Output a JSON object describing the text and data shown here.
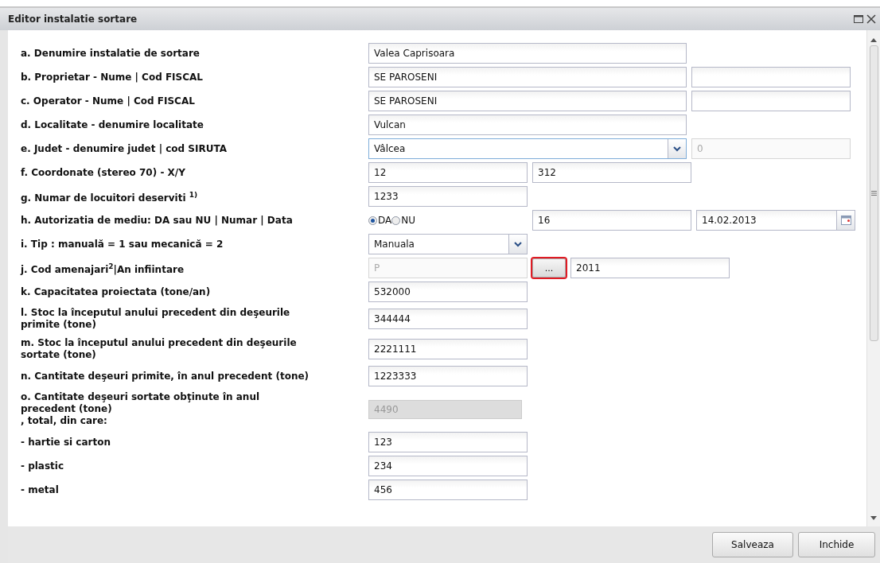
{
  "window": {
    "title": "Editor instalatie sortare"
  },
  "rows": [
    {
      "label": "a. Denumire instalatie de sortare",
      "controls": [
        {
          "kind": "longtext",
          "value": "Valea Caprisoara"
        }
      ]
    },
    {
      "label": "b. Proprietar - Nume | Cod FISCAL",
      "controls": [
        {
          "kind": "longtext",
          "value": "SE PAROSENI"
        },
        {
          "kind": "shorttext"
        }
      ]
    },
    {
      "label": "c. Operator - Nume | Cod FISCAL",
      "controls": [
        {
          "kind": "longtext",
          "value": "SE PAROSENI"
        },
        {
          "kind": "shorttext"
        }
      ]
    },
    {
      "label": "d. Localitate - denumire localitate",
      "controls": [
        {
          "kind": "longtext",
          "value": "Vulcan"
        }
      ]
    },
    {
      "label": "e. Judet - denumire judet | cod SIRUTA",
      "controls": [
        {
          "kind": "longcombo",
          "value": "Vâlcea",
          "focused": true
        },
        {
          "kind": "shorttext",
          "value": "0",
          "disabled": true
        }
      ]
    },
    {
      "label": "f. Coordonate (stereo 70) - X/Y",
      "controls": [
        {
          "kind": "shorttext",
          "value": "12"
        },
        {
          "kind": "shorttext",
          "value": "312"
        }
      ]
    },
    {
      "label": "g. Numar de locuitori deserviti $^{1)}$",
      "controls": [
        {
          "kind": "shorttext",
          "value": "1233"
        }
      ]
    },
    {
      "label": "h. Autorizatia de mediu: DA sau NU | Numar | Data",
      "controls": [
        {
          "kind": "radio",
          "options": [
            {
              "label": "DA",
              "selected": true
            },
            {
              "label": "NU",
              "selected": false
            }
          ]
        },
        {
          "kind": "shorttext",
          "value": "16"
        },
        {
          "kind": "date",
          "value": "14.02.2013"
        }
      ]
    },
    {
      "label": "i. Tip : manuală = 1 sau mecanică = 2",
      "controls": [
        {
          "kind": "shortcombo",
          "value": "Manuala",
          "focused": false
        }
      ]
    },
    {
      "label": "j. Cod amenajari$^{2}$|An infiintare",
      "controls": [
        {
          "kind": "shorttext",
          "value": "P",
          "disabled": true
        },
        {
          "kind": "button",
          "label": "...",
          "highlighted": true
        },
        {
          "kind": "shorttext",
          "value": "2011"
        }
      ]
    },
    {
      "label": "k. Capacitatea proiectata (tone/an)",
      "controls": [
        {
          "kind": "shorttext",
          "value": "532000"
        }
      ]
    },
    {
      "label": "l. Stoc la începutul anului precedent din deşeurile\nprimite (tone)",
      "controls": [
        {
          "kind": "shorttext",
          "value": "344444"
        }
      ]
    },
    {
      "label": "m. Stoc la începutul anului precedent din deşeurile\nsortate (tone)",
      "controls": [
        {
          "kind": "shorttext",
          "value": "2221111"
        }
      ]
    },
    {
      "label": "n. Cantitate deşeuri primite, în anul precedent (tone)",
      "controls": [
        {
          "kind": "shorttext",
          "value": "1223333"
        }
      ]
    },
    {
      "label": "o. Cantitate deşeuri sortate obţinute în anul\nprecedent (tone)\n, total, din care:",
      "controls": [
        {
          "kind": "shorttext",
          "value": "4490",
          "disabled": true
        }
      ]
    },
    {
      "label": "- hartie si carton",
      "controls": [
        {
          "kind": "shorttext",
          "value": "123"
        }
      ]
    },
    {
      "label": "- plastic",
      "controls": [
        {
          "kind": "shorttext",
          "value": "234"
        }
      ]
    },
    {
      "label": "- metal",
      "controls": [
        {
          "kind": "shorttext",
          "value": "456"
        }
      ]
    }
  ],
  "buttons": [
    "Salveaza",
    "Inchide"
  ]
}
